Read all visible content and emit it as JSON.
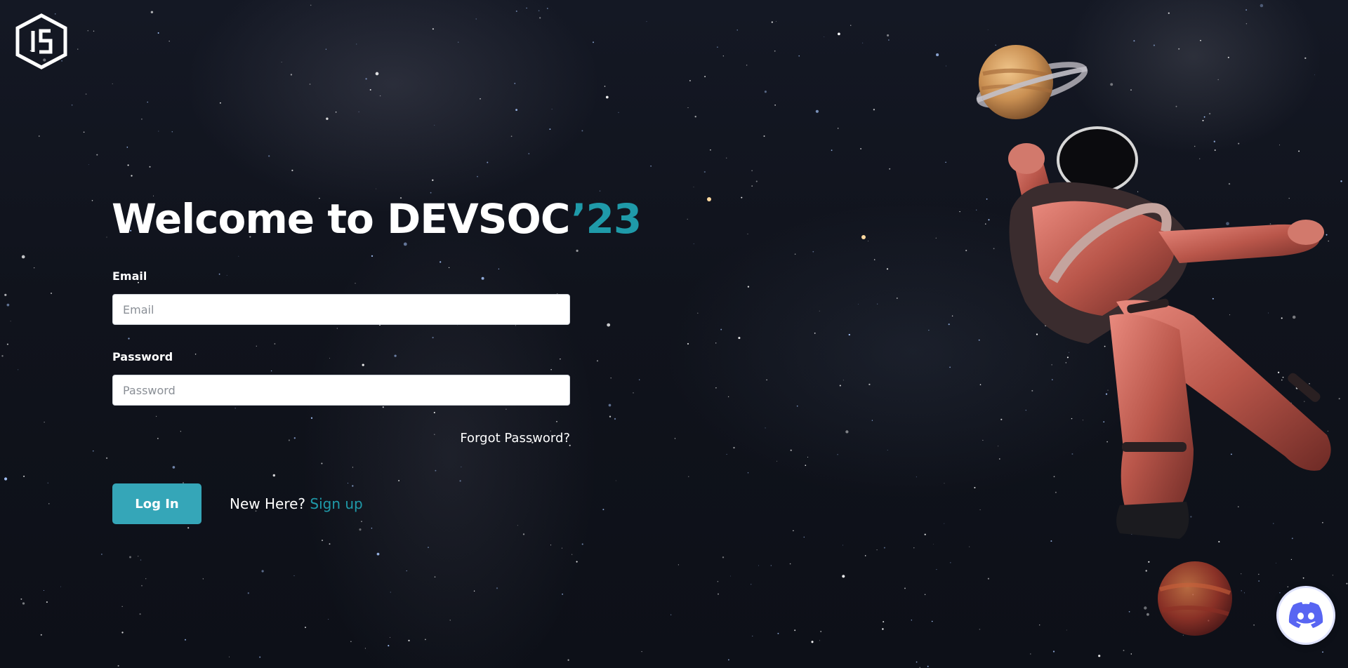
{
  "brand": {
    "logo_icon": "devsoc-hexagon-logo-icon"
  },
  "heading": {
    "prefix": "Welcome to DEVSOC",
    "accent": "’23",
    "accent_color": "#1f9aa9"
  },
  "form": {
    "email": {
      "label": "Email",
      "value": "",
      "placeholder": "Email"
    },
    "password": {
      "label": "Password",
      "value": "",
      "placeholder": "Password"
    },
    "forgot_label": "Forgot Password?",
    "login_label": "Log In",
    "login_color": "#35a6b8",
    "signup_prompt": "New Here? ",
    "signup_label": "Sign up"
  },
  "floating": {
    "discord_icon": "discord-icon"
  },
  "illustrations": [
    "ringed-planet-icon",
    "astronaut-illustration",
    "red-planet-icon"
  ]
}
